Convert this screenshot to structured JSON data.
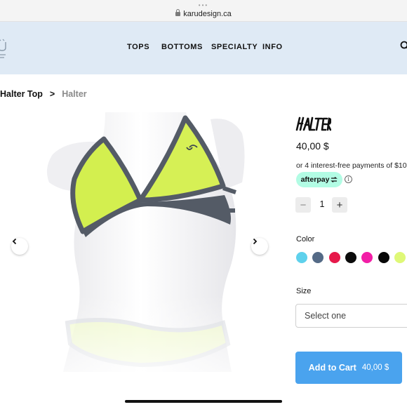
{
  "browser": {
    "url": "karudesign.ca"
  },
  "header": {
    "nav": [
      "TOPS",
      "BOTTOMS",
      "SPECIALTY",
      "INFO"
    ]
  },
  "breadcrumb": {
    "parent": "Halter Top",
    "separator": ">",
    "current": "Halter"
  },
  "product": {
    "price": "40,00 $",
    "afterpay_text": "or 4 interest-free payments of $10",
    "afterpay_badge": "afterpay",
    "quantity": "1",
    "qty_minus": "−",
    "qty_plus": "+",
    "color_label": "Color",
    "colors": [
      "#5ed1ec",
      "#546a86",
      "#e6194a",
      "#0b0b0b",
      "#f21ea6",
      "#080808",
      "#dff877"
    ],
    "size_label": "Size",
    "size_placeholder": "Select one",
    "add_to_cart": "Add to Cart",
    "cart_price": "40,00 $"
  },
  "icons": {
    "lock": "lock-icon",
    "search": "search-icon",
    "prev": "chevron-left-icon",
    "next": "chevron-right-icon",
    "info": "info-icon"
  }
}
